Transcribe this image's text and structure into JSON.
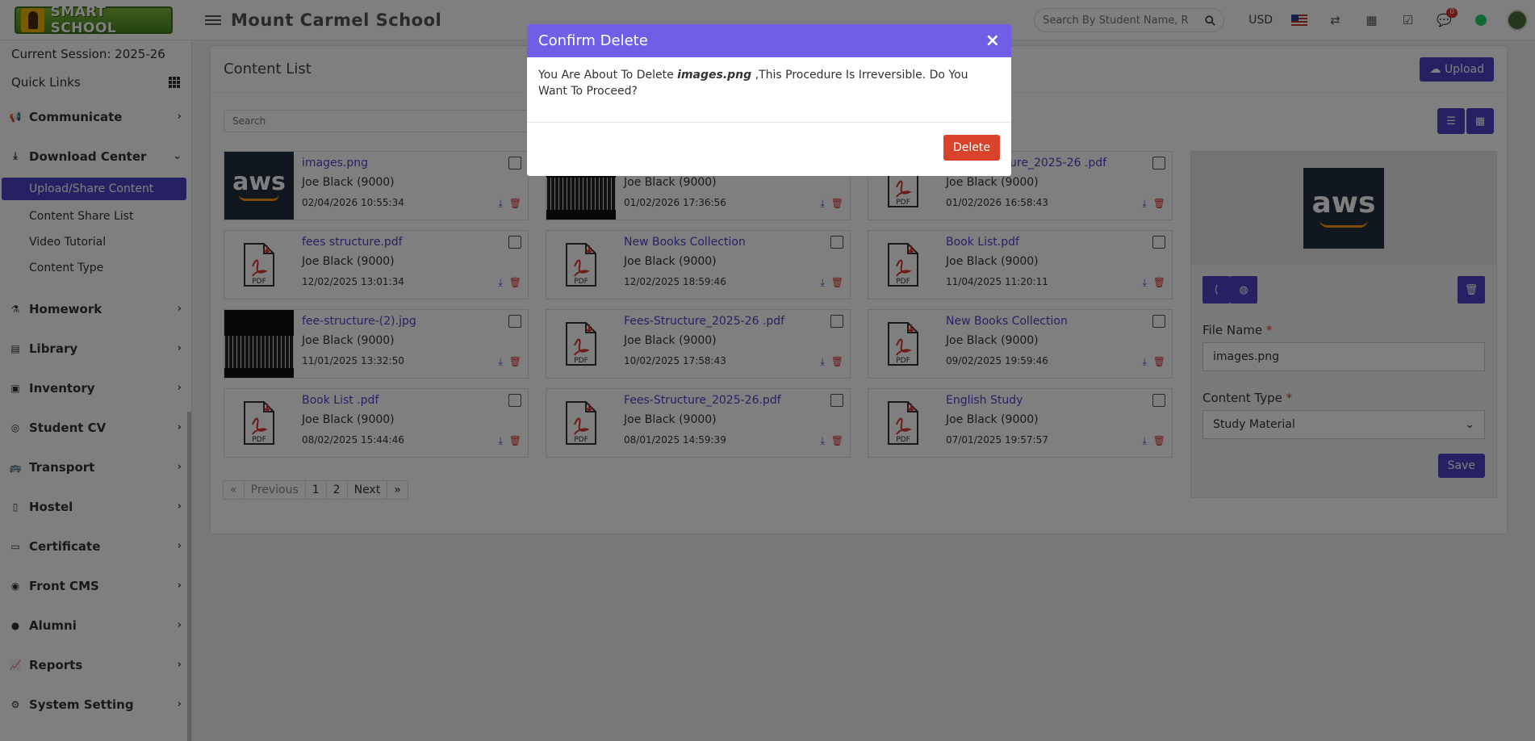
{
  "header": {
    "logo_text": "SMART SCHOOL",
    "school_name": "Mount Carmel School",
    "search_placeholder": "Search By Student Name, R",
    "currency": "USD",
    "notification_count": "0"
  },
  "sidebar": {
    "session": "Current Session: 2025-26",
    "quick_links": "Quick Links",
    "items": [
      {
        "label": "Communicate",
        "icon": "megaphone-icon"
      },
      {
        "label": "Download Center",
        "icon": "download-icon",
        "expanded": true
      },
      {
        "label": "Homework",
        "icon": "flask-icon"
      },
      {
        "label": "Library",
        "icon": "book-icon"
      },
      {
        "label": "Inventory",
        "icon": "inventory-icon"
      },
      {
        "label": "Student CV",
        "icon": "cv-icon"
      },
      {
        "label": "Transport",
        "icon": "bus-icon"
      },
      {
        "label": "Hostel",
        "icon": "building-icon"
      },
      {
        "label": "Certificate",
        "icon": "certificate-icon"
      },
      {
        "label": "Front CMS",
        "icon": "globe-icon"
      },
      {
        "label": "Alumni",
        "icon": "alumni-icon"
      },
      {
        "label": "Reports",
        "icon": "chart-icon"
      },
      {
        "label": "System Setting",
        "icon": "gears-icon"
      }
    ],
    "download_center_sub": [
      {
        "label": "Upload/Share Content",
        "active": true
      },
      {
        "label": "Content Share List"
      },
      {
        "label": "Video Tutorial"
      },
      {
        "label": "Content Type"
      }
    ]
  },
  "content": {
    "title": "Content List",
    "upload_label": "Upload",
    "search_placeholder": "Search",
    "cards": [
      {
        "name": "images.png",
        "owner": "Joe Black (9000)",
        "date": "02/04/2026 10:55:34",
        "thumb": "aws"
      },
      {
        "name": "",
        "owner": "Joe Black (9000)",
        "date": "01/02/2026 17:36:56",
        "thumb": "dark"
      },
      {
        "name": "Fees-Structure_2025-26 .pdf",
        "owner": "Joe Black (9000)",
        "date": "01/02/2026 16:58:43",
        "thumb": "pdf"
      },
      {
        "name": "fees structure.pdf",
        "owner": "Joe Black (9000)",
        "date": "12/02/2025 13:01:34",
        "thumb": "pdf"
      },
      {
        "name": "New Books Collection",
        "owner": "Joe Black (9000)",
        "date": "12/02/2025 18:59:46",
        "thumb": "pdf"
      },
      {
        "name": "Book List.pdf",
        "owner": "Joe Black (9000)",
        "date": "11/04/2025 11:20:11",
        "thumb": "pdf"
      },
      {
        "name": "fee-structure-(2).jpg",
        "owner": "Joe Black (9000)",
        "date": "11/01/2025 13:32:50",
        "thumb": "dark"
      },
      {
        "name": "Fees-Structure_2025-26 .pdf",
        "owner": "Joe Black (9000)",
        "date": "10/02/2025 17:58:43",
        "thumb": "pdf"
      },
      {
        "name": "New Books Collection",
        "owner": "Joe Black (9000)",
        "date": "09/02/2025 19:59:46",
        "thumb": "pdf"
      },
      {
        "name": "Book List .pdf",
        "owner": "Joe Black (9000)",
        "date": "08/02/2025 15:44:46",
        "thumb": "pdf"
      },
      {
        "name": "Fees-Structure_2025-26.pdf",
        "owner": "Joe Black (9000)",
        "date": "08/01/2025 14:59:39",
        "thumb": "pdf"
      },
      {
        "name": "English Study",
        "owner": "Joe Black (9000)",
        "date": "07/01/2025 19:57:57",
        "thumb": "pdf"
      }
    ],
    "pagination": {
      "prev": "Previous",
      "next": "Next",
      "pages": [
        "1",
        "2"
      ]
    },
    "pdf_label": "PDF",
    "aws_label": "aws"
  },
  "detail": {
    "file_name_label": "File Name",
    "file_name_value": "images.png",
    "content_type_label": "Content Type",
    "content_type_value": "Study Material",
    "save_label": "Save"
  },
  "modal": {
    "title": "Confirm Delete",
    "close": "×",
    "text_before": "You Are About To Delete ",
    "file": "images.png",
    "text_after": " ,This Procedure Is Irreversible. Do You Want To Proceed?",
    "delete_label": "Delete"
  },
  "colors": {
    "primary": "#4d43c6",
    "modal_header": "#6f5ee6",
    "danger": "#d9432b"
  }
}
